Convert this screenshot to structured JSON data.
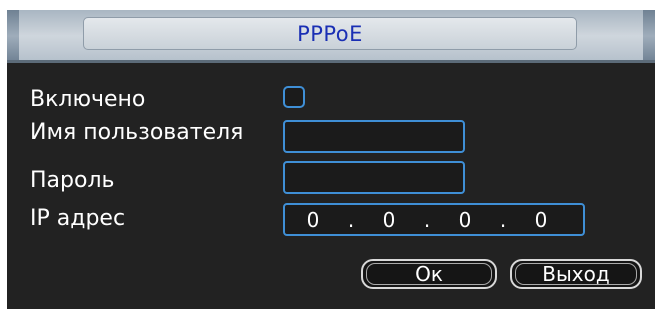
{
  "dialog": {
    "title": "PPPoE"
  },
  "form": {
    "enabled_label": "Включено",
    "enabled_checked": false,
    "username_label": "Имя пользователя",
    "username_value": "",
    "password_label": "Пароль",
    "password_value": "",
    "ip_label": "IP адрес",
    "ip_parts": [
      "0",
      "0",
      "0",
      "0"
    ],
    "ip_separator": "."
  },
  "buttons": {
    "ok_label": "Ок",
    "exit_label": "Выход"
  },
  "colors": {
    "field_border": "#3f8fd6",
    "title_text": "#1a2fb4",
    "dialog_bg": "#222222"
  }
}
